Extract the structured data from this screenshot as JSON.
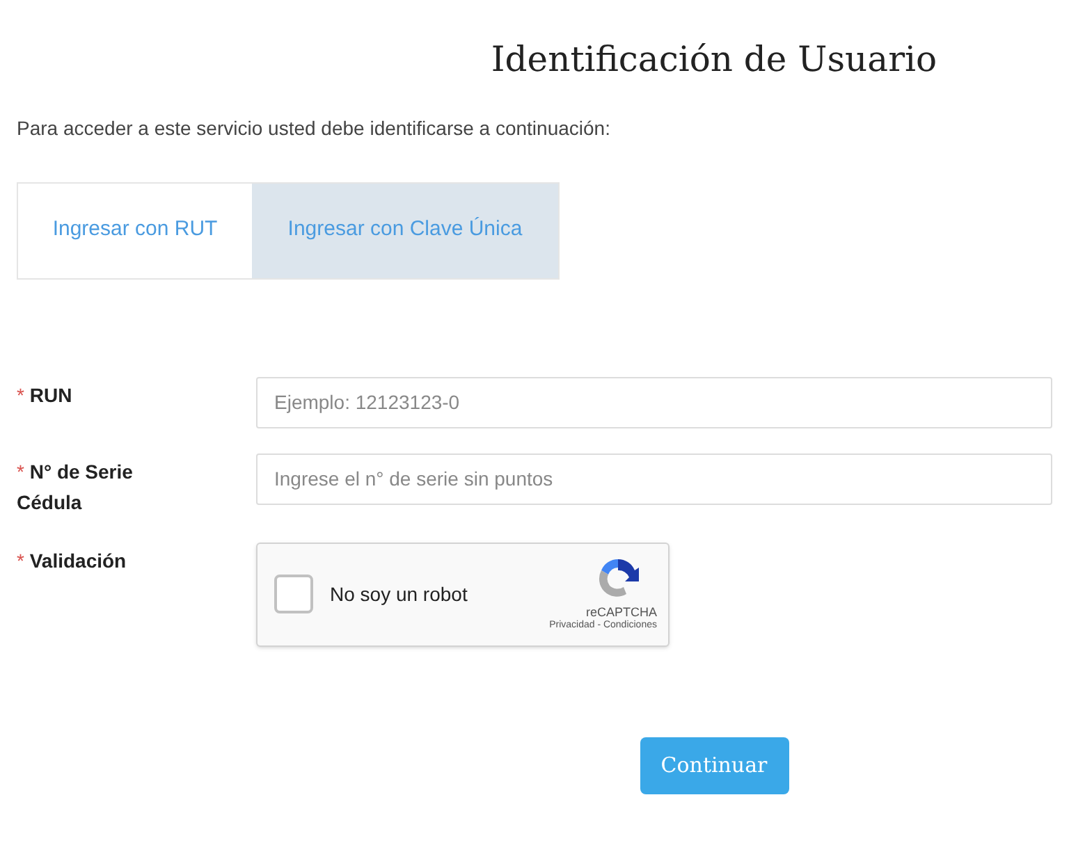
{
  "title": "Identificación de Usuario",
  "intro": "Para acceder a este servicio usted debe identificarse a continuación:",
  "tabs": [
    {
      "label": "Ingresar con RUT",
      "selected": false
    },
    {
      "label": "Ingresar con Clave Única",
      "selected": true
    }
  ],
  "fields": [
    {
      "kind": "text",
      "required_mark": "*",
      "label": "RUN",
      "placeholder": "Ejemplo: 12123123-0"
    },
    {
      "kind": "text",
      "required_mark": "*",
      "label": "N° de Serie Cédula",
      "placeholder": "Ingrese el n° de serie sin puntos"
    },
    {
      "kind": "captcha",
      "required_mark": "*",
      "label": "Validación",
      "checkbox_label": "No soy un robot",
      "checked": false,
      "brand": "reCAPTCHA",
      "links": "Privacidad - Condiciones"
    }
  ],
  "submit": "Continuar"
}
